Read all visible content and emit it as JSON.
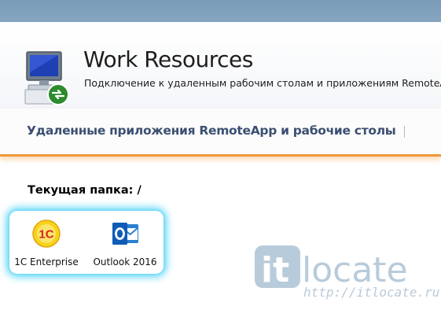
{
  "header": {
    "title": "Work Resources",
    "subtitle": "Подключение к удаленным рабочим столам и приложениям RemoteApp",
    "icon": "remote-desktop-computer-icon"
  },
  "nav": {
    "tab_label": "Удаленные приложения RemoteApp и рабочие столы"
  },
  "folder": {
    "label": "Текущая папка: /"
  },
  "apps": [
    {
      "label": "1C Enterprise",
      "icon": "1c-enterprise-icon"
    },
    {
      "label": "Outlook 2016",
      "icon": "outlook-icon"
    }
  ],
  "watermark": {
    "logo_text": "itlocate",
    "url": "http://itlocate.ru"
  },
  "colors": {
    "top_bar": "#7a9bb8",
    "nav_text": "#3b4f72",
    "accent_orange": "#f0973a",
    "panel_glow": "#5fd6f6",
    "watermark": "#b8cbda"
  }
}
